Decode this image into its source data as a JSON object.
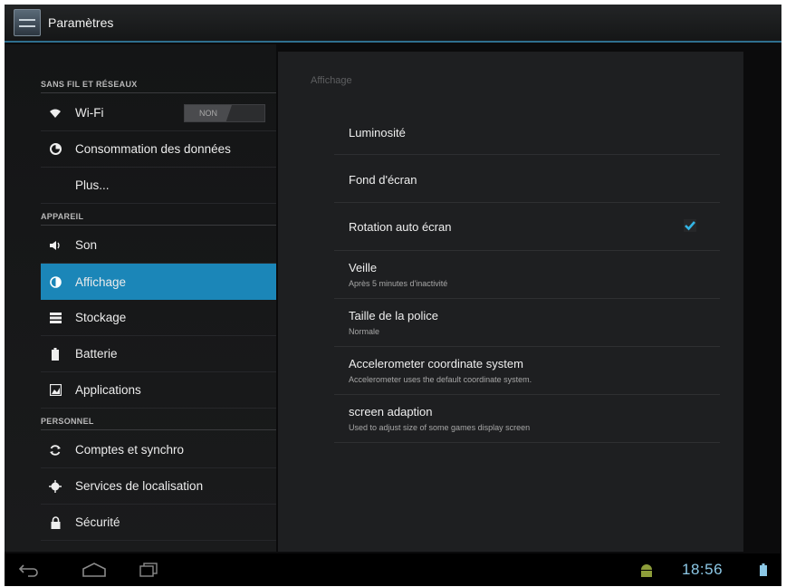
{
  "window": {
    "title": "Paramètres"
  },
  "left_nav": {
    "sections": [
      {
        "id": "wireless",
        "header": "SANS FIL ET RÉSEAUX"
      },
      {
        "id": "device",
        "header": "APPAREIL"
      },
      {
        "id": "personal",
        "header": "PERSONNEL"
      }
    ],
    "items": [
      {
        "label": "Wi-Fi",
        "icon": "wifi-icon",
        "toggle": "NON"
      },
      {
        "label": "Consommation des données",
        "icon": "data-usage-icon"
      },
      {
        "label": "Plus..."
      },
      {
        "label": "Son",
        "icon": "speaker-icon"
      },
      {
        "label": "Affichage",
        "icon": "brightness-icon",
        "active": true
      },
      {
        "label": "Stockage",
        "icon": "storage-icon"
      },
      {
        "label": "Batterie",
        "icon": "battery-icon"
      },
      {
        "label": "Applications",
        "icon": "apps-icon"
      },
      {
        "label": "Comptes et synchro",
        "icon": "sync-icon"
      },
      {
        "label": "Services de localisation",
        "icon": "location-icon"
      },
      {
        "label": "Sécurité",
        "icon": "lock-icon"
      }
    ]
  },
  "content": {
    "title": "Affichage",
    "prefs": [
      {
        "title": "Luminosité"
      },
      {
        "title": "Fond d'écran"
      },
      {
        "title": "Rotation auto écran",
        "checked": true
      },
      {
        "title": "Veille",
        "summary": "Après 5 minutes d'inactivité"
      },
      {
        "title": "Taille de la police",
        "summary": "Normale"
      },
      {
        "title": "Accelerometer coordinate system",
        "summary": "Accelerometer uses the default coordinate system."
      },
      {
        "title": "screen adaption",
        "summary": "Used to adjust size of some games display screen"
      }
    ]
  },
  "status_bar": {
    "time": "18:56"
  },
  "colors": {
    "accent": "#1b86b8",
    "clock": "#8cc8e6",
    "check": "#33b5e5"
  }
}
